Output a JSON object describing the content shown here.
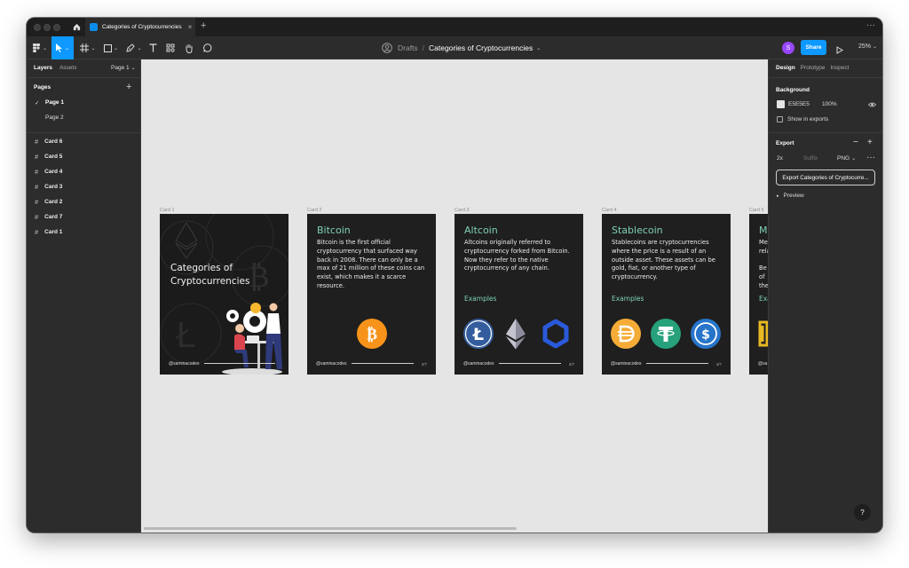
{
  "tab": {
    "title": "Categories of Cryptocurrencies",
    "close": "×",
    "new_tab": "+",
    "menu": "···"
  },
  "toolbar": {
    "breadcrumb_drafts": "Drafts",
    "breadcrumb_sep": "/",
    "file_name": "Categories of Cryptocurrencies",
    "user_initial": "S",
    "share_label": "Share",
    "zoom": "25%"
  },
  "left_panel": {
    "tab_layers": "Layers",
    "tab_assets": "Assets",
    "page_selector": "Page 1",
    "pages_heading": "Pages",
    "pages": [
      {
        "label": "Page 1",
        "selected": true
      },
      {
        "label": "Page 2",
        "selected": false
      }
    ],
    "layers": [
      "Card 6",
      "Card 5",
      "Card 4",
      "Card 3",
      "Card 2",
      "Card 7",
      "Card 1"
    ]
  },
  "canvas": {
    "frame_labels": [
      "Card 1",
      "Card 2",
      "Card 3",
      "Card 4",
      "Card 5"
    ],
    "cards": {
      "cover": {
        "title_line1": "Categories of",
        "title_line2": "Cryptocurrencies",
        "handle": "@saminacodes"
      },
      "bitcoin": {
        "title": "Bitcoin",
        "body": "Bitcoin is the first official cryptocurrency that surfaced way back in 2008. There can only be a max of 21 million of these coins can exist, which makes it a scarce resource.",
        "handle": "@saminacodes",
        "page": "2/7"
      },
      "altcoin": {
        "title": "Altcoin",
        "body": "Altcoins originally referred to cryptocurrency forked from Bitcoin. Now they refer to the native cryptocurrency of any chain.",
        "examples": "Examples",
        "handle": "@saminacodes",
        "page": "3/7"
      },
      "stablecoin": {
        "title": "Stablecoin",
        "body": "Stablecoins are cryptocurrencies where the price is a result of an outside asset. These assets can be gold, fiat, or another type of cryptocurrency.",
        "examples": "Examples",
        "handle": "@saminacodes",
        "page": "4/7"
      },
      "partial": {
        "title": "Me",
        "line1": "Me",
        "line2": "rela",
        "line3": "Be",
        "line4": "of",
        "line5": "the",
        "examples": "Exa",
        "handle": "@sa"
      }
    }
  },
  "right_panel": {
    "tab_design": "Design",
    "tab_prototype": "Prototype",
    "tab_inspect": "Inspect",
    "background_heading": "Background",
    "bg_hex": "E5E5E5",
    "bg_opacity": "100%",
    "show_in_exports": "Show in exports",
    "export_heading": "Export",
    "export_scale": "2x",
    "export_suffix_placeholder": "Suffix",
    "export_format": "PNG",
    "export_button": "Export Categories of Cryptocurre...",
    "preview": "Preview"
  },
  "help_label": "?",
  "colors": {
    "accent": "#0d99ff",
    "card_bg": "#1f1f1f",
    "card_title": "#7ed1b5",
    "canvas_bg": "#e5e5e5",
    "bitcoin": "#f7931a",
    "litecoin": "#345d9d",
    "chainlink": "#2a5ada",
    "dai": "#f5ac37",
    "tether": "#26a17b",
    "usdc": "#2775ca"
  },
  "icons": [
    "home-icon",
    "figma-menu-icon",
    "move-tool-icon",
    "frame-tool-icon",
    "shape-tool-icon",
    "pen-tool-icon",
    "text-tool-icon",
    "components-icon",
    "hand-tool-icon",
    "comment-icon",
    "play-icon",
    "eye-icon",
    "bitcoin-logo",
    "litecoin-logo",
    "ethereum-logo",
    "chainlink-logo",
    "dai-logo",
    "tether-logo",
    "usdc-logo"
  ]
}
